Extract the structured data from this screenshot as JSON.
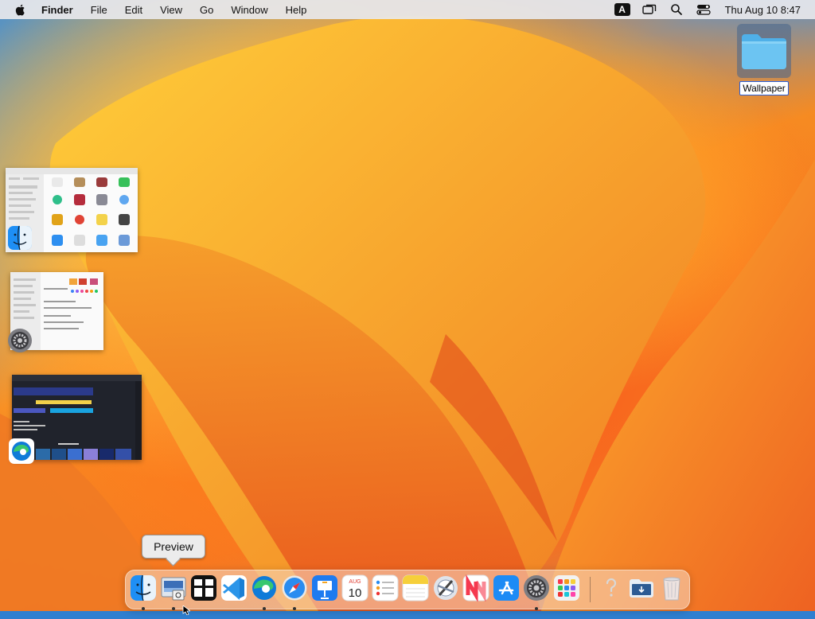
{
  "menubar": {
    "apple_icon": "apple-logo-icon",
    "app_name": "Finder",
    "menus": [
      "File",
      "Edit",
      "View",
      "Go",
      "Window",
      "Help"
    ],
    "input_source": "A",
    "status_icons": [
      "input-source-icon",
      "screen-mirroring-icon",
      "spotlight-search-icon",
      "control-center-icon"
    ],
    "clock": "Thu Aug 10  8:47"
  },
  "desktop": {
    "folder_label": "Wallpaper",
    "folder_icon": "folder-icon"
  },
  "expose_windows": [
    {
      "app": "Finder",
      "icon": "finder-icon"
    },
    {
      "app": "System Settings",
      "icon": "system-settings-icon"
    },
    {
      "app": "Microsoft Edge",
      "icon": "edge-icon"
    }
  ],
  "tooltip": {
    "label": "Preview"
  },
  "dock": {
    "items": [
      {
        "name": "Finder",
        "icon": "finder-icon",
        "running": true
      },
      {
        "name": "Preview",
        "icon": "preview-icon",
        "running": true
      },
      {
        "name": "Mission Control",
        "icon": "mission-control-icon",
        "running": false
      },
      {
        "name": "Visual Studio Code",
        "icon": "vscode-icon",
        "running": false
      },
      {
        "name": "Microsoft Edge",
        "icon": "edge-icon",
        "running": true
      },
      {
        "name": "Safari",
        "icon": "safari-icon",
        "running": true
      },
      {
        "name": "Keynote",
        "icon": "keynote-icon",
        "running": false
      },
      {
        "name": "Calendar",
        "icon": "calendar-icon",
        "running": false,
        "month": "AUG",
        "day": "10"
      },
      {
        "name": "Reminders",
        "icon": "reminders-icon",
        "running": false
      },
      {
        "name": "Notes",
        "icon": "notes-icon",
        "running": false
      },
      {
        "name": "Xcode Instruments",
        "icon": "instruments-icon",
        "running": false
      },
      {
        "name": "News",
        "icon": "news-icon",
        "running": false
      },
      {
        "name": "App Store",
        "icon": "app-store-icon",
        "running": false
      },
      {
        "name": "System Settings",
        "icon": "system-settings-icon",
        "running": true
      },
      {
        "name": "Launchpad",
        "icon": "launchpad-icon",
        "running": false
      },
      {
        "name": "Help Viewer",
        "icon": "help-icon",
        "running": false
      },
      {
        "name": "Downloads",
        "icon": "downloads-folder-icon",
        "running": false
      },
      {
        "name": "Trash",
        "icon": "trash-icon",
        "running": false
      }
    ]
  },
  "colors": {
    "accent": "#2a5fd9",
    "wallpaper_orange": "#f0802a",
    "wallpaper_blue": "#3a86d6"
  }
}
